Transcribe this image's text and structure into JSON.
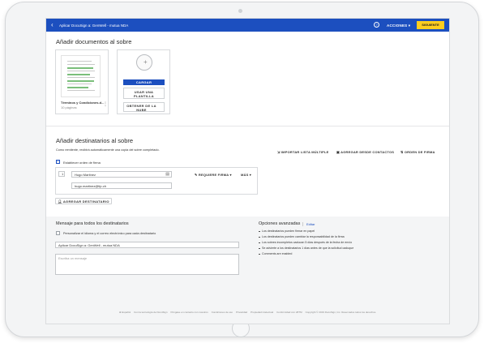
{
  "topbar": {
    "back_icon": "chevron-left-icon",
    "title": "Aplicar DocuSign a: GenWell - mutua NDA",
    "help_icon": "help-icon",
    "actions_label": "ACCIONES ▾",
    "next_label": "SIGUIENTE",
    "colors": {
      "bar": "#1c4fbf",
      "next": "#ffce1f"
    }
  },
  "documents": {
    "heading": "Añadir documentos al sobre",
    "doc_name": "Términos y Condiciones.d...",
    "doc_pages": "10 páginas",
    "upload_label": "CARGAR",
    "template_label": "USAR UNA PLANTILLA",
    "cloud_label": "OBTENER DE LA NUBE"
  },
  "recipients": {
    "heading": "Añadir destinatarios al sobre",
    "subtitle": "Como remitente, recibirá automáticamente una copia del sobre completado.",
    "bulk_list": "IMPORTAR LISTA MÚLTIPLE",
    "from_contacts": "AGREGAR DESDE CONTACTOS",
    "signing_order_link": "ORDEN DE FIRMA",
    "set_signing_order": "Establecer orden de firma",
    "order_number": "1",
    "name_value": "Hugo Martinez",
    "email_value": "hugo.martinez@tlp.ch",
    "role_label": "REQUIERE FIRMA ▾",
    "more_label": "MÁS ▾",
    "add_recipient": "AGREGAR DESTINATARIO"
  },
  "message": {
    "heading": "Mensaje para todos los destinatarios",
    "customize_label": "Personalizar el idioma y el correo electrónico para cada destinatario",
    "subject_value": "Aplicar DocuSign a: GenWell - mutua NDA",
    "message_placeholder": "Escriba un mensaje"
  },
  "advanced": {
    "heading": "Opciones avanzadas",
    "edit_label": "Editar",
    "items": [
      "Los destinatarios pueden firmar en papel",
      "Los destinatarios pueden cambiar la responsabilidad de la firma",
      "Los sobres incompletos caducan 5 días después de la fecha de envío",
      "Se advierte a los destinatarios 1 días antes de que la solicitud caduque",
      "Comments are enabled"
    ]
  },
  "footer": {
    "items": [
      "Español",
      "Con la tecnología de DocuSign",
      "Póngase en contacto con nosotros",
      "Condiciones de uso",
      "Privacidad",
      "Propiedad intelectual",
      "Conformidad con xBTM",
      "Copyright © 2019 DocuSign, Inc. Reservados todos los derechos."
    ]
  }
}
